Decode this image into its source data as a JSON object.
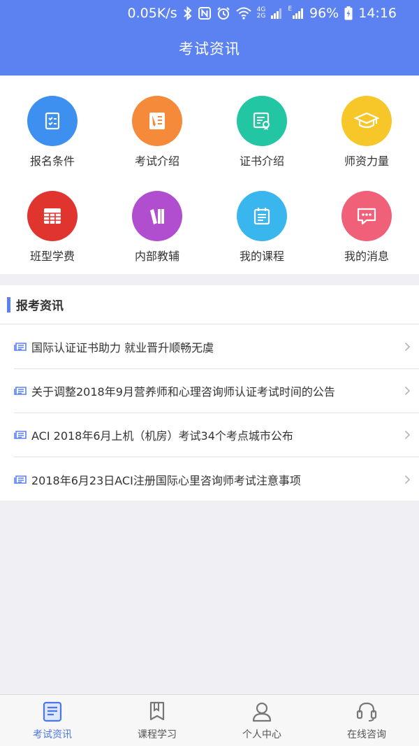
{
  "status_bar": {
    "network_speed": "0.05K/s",
    "network_4g": "4G",
    "network_2g": "2G",
    "network_e": "E",
    "battery": "96%",
    "time": "14:16"
  },
  "header": {
    "title": "考试资讯"
  },
  "grid": [
    {
      "label": "报名条件",
      "icon": "checklist-icon",
      "color": "#3d8ff0"
    },
    {
      "label": "考试介绍",
      "icon": "document-pen-icon",
      "color": "#f58a3a"
    },
    {
      "label": "证书介绍",
      "icon": "certificate-icon",
      "color": "#22c6a3"
    },
    {
      "label": "师资力量",
      "icon": "graduation-cap-icon",
      "color": "#f7c72a"
    },
    {
      "label": "班型学费",
      "icon": "table-icon",
      "color": "#e0342f"
    },
    {
      "label": "内部教辅",
      "icon": "books-icon",
      "color": "#b14ed0"
    },
    {
      "label": "我的课程",
      "icon": "calendar-note-icon",
      "color": "#3ab6ee"
    },
    {
      "label": "我的消息",
      "icon": "message-icon",
      "color": "#f06078"
    }
  ],
  "news": {
    "title": "报考资讯",
    "items": [
      "国际认证证书助力 就业晋升顺畅无虞",
      "关于调整2018年9月营养师和心理咨询师认证考试时间的公告",
      "ACI 2018年6月上机（机房）考试34个考点城市公布",
      "2018年6月23日ACI注册国际心里咨询师考试注意事项"
    ]
  },
  "tabbar": {
    "active_color": "#4d76e8",
    "tabs": [
      {
        "label": "考试资讯",
        "icon": "news-icon"
      },
      {
        "label": "课程学习",
        "icon": "bookmark-book-icon"
      },
      {
        "label": "个人中心",
        "icon": "person-icon"
      },
      {
        "label": "在线咨询",
        "icon": "headset-icon"
      }
    ]
  }
}
